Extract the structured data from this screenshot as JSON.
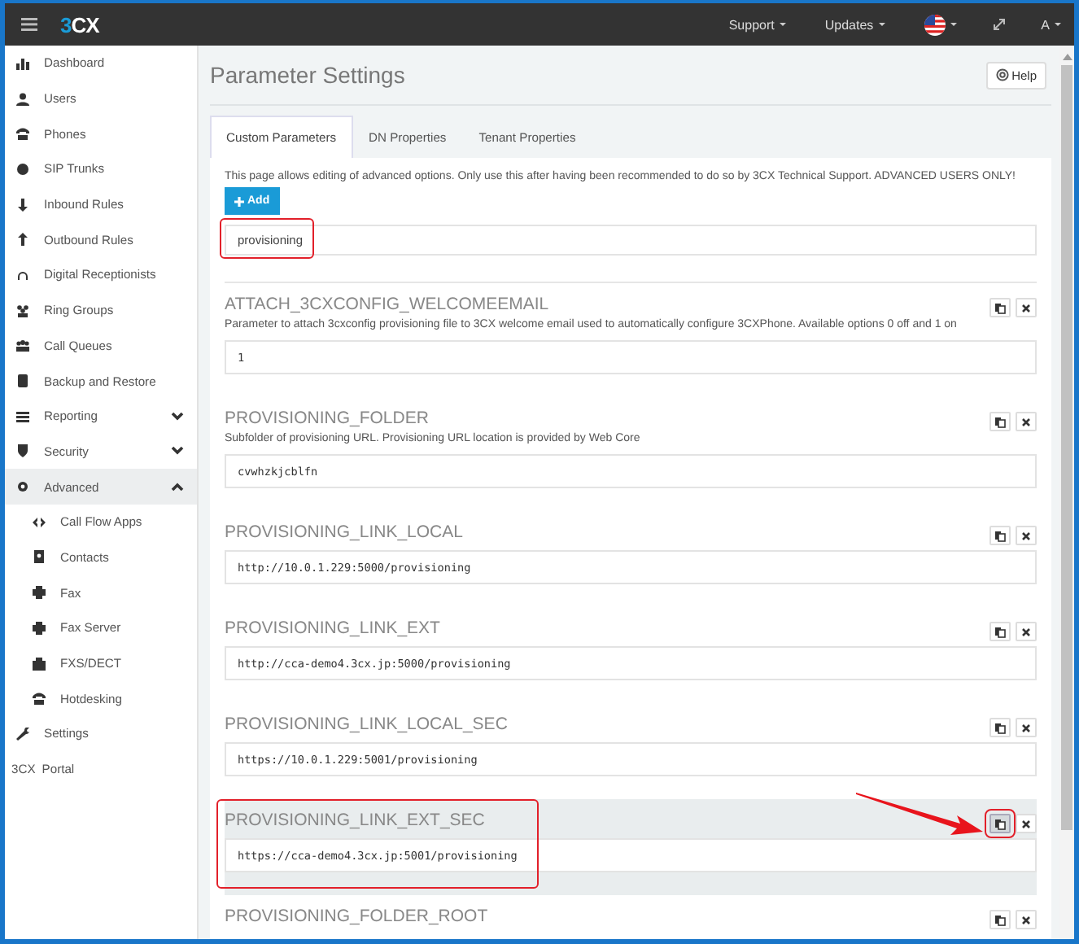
{
  "topbar": {
    "logo": {
      "accent": "3",
      "rest": "CX"
    },
    "menus": [
      "Support",
      "Updates"
    ],
    "user": "A"
  },
  "sidebar": {
    "items": [
      {
        "label": "Dashboard"
      },
      {
        "label": "Users"
      },
      {
        "label": "Phones"
      },
      {
        "label": "SIP Trunks"
      },
      {
        "label": "Inbound Rules"
      },
      {
        "label": "Outbound Rules"
      },
      {
        "label": "Digital Receptionists"
      },
      {
        "label": "Ring Groups"
      },
      {
        "label": "Call Queues"
      },
      {
        "label": "Backup and Restore"
      },
      {
        "label": "Reporting",
        "expanded": false
      },
      {
        "label": "Security",
        "expanded": false
      },
      {
        "label": "Advanced",
        "expanded": true,
        "children": [
          {
            "label": "Call Flow Apps"
          },
          {
            "label": "Contacts"
          },
          {
            "label": "Fax"
          },
          {
            "label": "Fax Server"
          },
          {
            "label": "FXS/DECT"
          },
          {
            "label": "Hotdesking"
          }
        ]
      },
      {
        "label": "Settings"
      },
      {
        "label": "Portal",
        "prefix": "3CX"
      }
    ]
  },
  "page": {
    "title": "Parameter Settings",
    "help_button": "Help"
  },
  "tabs": [
    {
      "label": "Custom Parameters",
      "selected": true
    },
    {
      "label": "DN Properties",
      "selected": false
    },
    {
      "label": "Tenant Properties",
      "selected": false
    }
  ],
  "notice": "This page allows editing of advanced options. Only use this after having been recommended to do so by 3CX Technical Support. ADVANCED USERS ONLY!",
  "add_button": "Add",
  "filter": {
    "value": "provisioning",
    "highlighted": true
  },
  "parameters": [
    {
      "name": "ATTACH_3CXCONFIG_WELCOMEEMAIL",
      "description": "Parameter to attach 3cxconfig provisioning file to 3CX welcome email used to automatically configure 3CXPhone. Available options 0 off and 1 on",
      "value": "1",
      "hovered": false,
      "highlighted": false,
      "copy_highlighted": false
    },
    {
      "name": "PROVISIONING_FOLDER",
      "description": "Subfolder of provisioning URL. Provisioning URL location is provided by Web Core",
      "value": "cvwhzkjcblfn",
      "hovered": false,
      "highlighted": false,
      "copy_highlighted": false
    },
    {
      "name": "PROVISIONING_LINK_LOCAL",
      "value": "http://10.0.1.229:5000/provisioning",
      "hovered": false,
      "highlighted": false,
      "copy_highlighted": false
    },
    {
      "name": "PROVISIONING_LINK_EXT",
      "value": "http://cca-demo4.3cx.jp:5000/provisioning",
      "hovered": false,
      "highlighted": false,
      "copy_highlighted": false
    },
    {
      "name": "PROVISIONING_LINK_LOCAL_SEC",
      "value": "https://10.0.1.229:5001/provisioning",
      "hovered": false,
      "highlighted": false,
      "copy_highlighted": false
    },
    {
      "name": "PROVISIONING_LINK_EXT_SEC",
      "value": "https://cca-demo4.3cx.jp:5001/provisioning",
      "hovered": true,
      "highlighted": true,
      "copy_highlighted": true
    },
    {
      "name": "PROVISIONING_FOLDER_ROOT",
      "hovered": false,
      "highlighted": false,
      "copy_highlighted": false
    }
  ]
}
